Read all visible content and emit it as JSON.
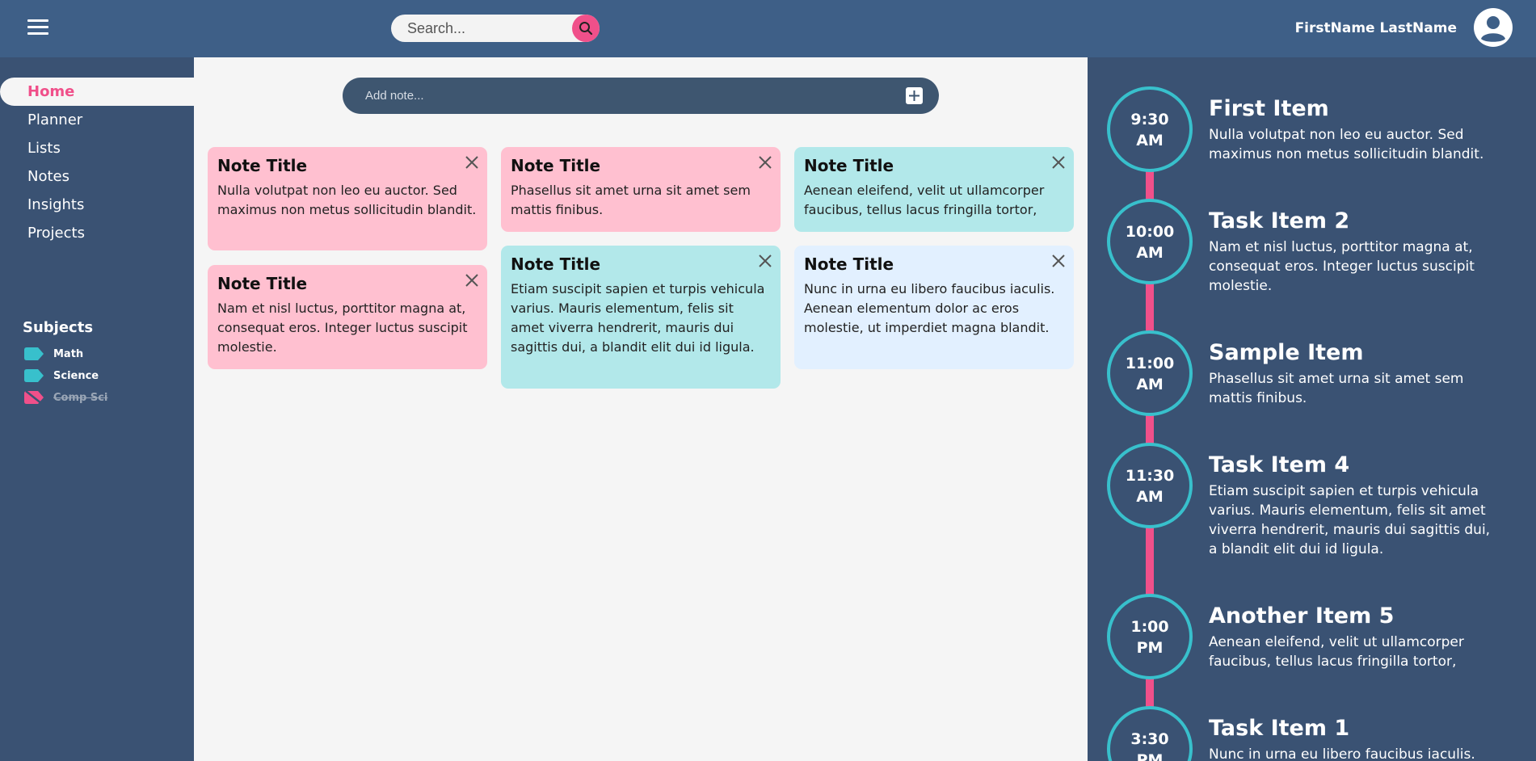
{
  "header": {
    "search_placeholder": "Search...",
    "user_name": "FirstName LastName"
  },
  "sidebar": {
    "items": [
      {
        "label": "Home",
        "active": true
      },
      {
        "label": "Planner"
      },
      {
        "label": "Lists"
      },
      {
        "label": "Notes"
      },
      {
        "label": "Insights"
      },
      {
        "label": "Projects"
      }
    ],
    "subjects_title": "Subjects",
    "subjects": [
      {
        "label": "Math",
        "color": "#38c0cc",
        "enabled": true
      },
      {
        "label": "Science",
        "color": "#38c0cc",
        "enabled": true
      },
      {
        "label": "Comp Sci",
        "color": "#f0508a",
        "enabled": false
      }
    ]
  },
  "main": {
    "add_note_placeholder": "Add note...",
    "notes": [
      {
        "title": "Note Title",
        "body": "Nulla volutpat non leo eu auctor. Sed maximus non metus sollicitudin blandit.",
        "color": "#ffc0d0"
      },
      {
        "title": "Note Title",
        "body": "Phasellus sit amet urna sit amet sem mattis finibus.",
        "color": "#ffc0d0"
      },
      {
        "title": "Note Title",
        "body": "Aenean eleifend, velit ut ullamcorper faucibus, tellus lacus fringilla tortor,",
        "color": "#b2e8ea"
      },
      {
        "title": "Note Title",
        "body": "Nam et nisl luctus, porttitor magna at, consequat eros. Integer luctus suscipit molestie.",
        "color": "#ffc0d0"
      },
      {
        "title": "Note Title",
        "body": "Etiam suscipit sapien et turpis vehicula varius. Mauris elementum, felis sit amet viverra hendrerit, mauris dui sagittis dui, a blandit elit dui id ligula.",
        "color": "#b2e8ea"
      },
      {
        "title": "Note Title",
        "body": "Nunc in urna eu libero faucibus iaculis. Aenean elementum dolor ac eros molestie, ut imperdiet magna blandit.",
        "color": "#e2f0ff"
      }
    ]
  },
  "timeline": {
    "items": [
      {
        "time": "9:30",
        "period": "AM",
        "title": "First Item",
        "desc": "Nulla volutpat non leo eu auctor. Sed maximus non metus sollicitudin blandit."
      },
      {
        "time": "10:00",
        "period": "AM",
        "title": "Task Item 2",
        "desc": "Nam et nisl luctus, porttitor magna at, consequat eros. Integer luctus suscipit molestie."
      },
      {
        "time": "11:00",
        "period": "AM",
        "title": "Sample Item",
        "desc": "Phasellus sit amet urna sit amet sem mattis finibus."
      },
      {
        "time": "11:30",
        "period": "AM",
        "title": "Task Item 4",
        "desc": "Etiam suscipit sapien et turpis vehicula varius. Mauris elementum, felis sit amet viverra hendrerit, mauris dui sagittis dui, a blandit elit dui id ligula."
      },
      {
        "time": "1:00",
        "period": "PM",
        "title": "Another Item 5",
        "desc": "Aenean eleifend, velit ut ullamcorper faucibus, tellus lacus fringilla tortor,"
      },
      {
        "time": "3:30",
        "period": "PM",
        "title": "Task Item 1",
        "desc": "Nunc in urna eu libero faucibus iaculis."
      }
    ]
  },
  "colors": {
    "header": "#3e5f87",
    "sidebar": "#3a5273",
    "accent_pink": "#f0508a",
    "accent_teal": "#38c0cc"
  }
}
